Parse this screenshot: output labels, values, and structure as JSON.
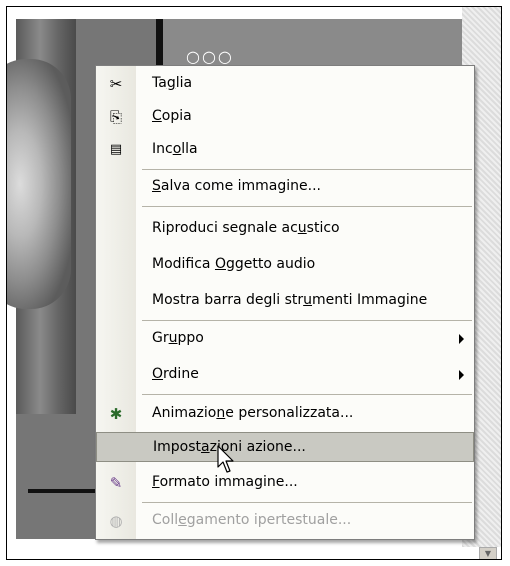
{
  "menu": {
    "items": [
      {
        "label": "Taglia",
        "icon": "scissors-icon",
        "glyph": "✂"
      },
      {
        "label": "Copia",
        "icon": "copy-icon",
        "glyph": "⎘"
      },
      {
        "label": "Incolla",
        "icon": "paste-icon",
        "glyph": "📋"
      },
      {
        "label": "Salva come immagine..."
      },
      {
        "label": "Riproduci segnale acustico"
      },
      {
        "label": "Modifica Oggetto audio"
      },
      {
        "label": "Mostra barra degli strumenti Immagine"
      },
      {
        "label": "Gruppo",
        "submenu": true
      },
      {
        "label": "Ordine",
        "submenu": true
      },
      {
        "label": "Animazione personalizzata...",
        "icon": "animation-icon",
        "glyph": "✱"
      },
      {
        "label": "Impostazioni azione...",
        "state": "hover"
      },
      {
        "label": "Formato immagine...",
        "icon": "format-picture-icon",
        "glyph": "✎"
      },
      {
        "label": "Collegamento ipertestuale...",
        "icon": "hyperlink-icon",
        "glyph": "◍",
        "state": "disabled"
      }
    ]
  },
  "colors": {
    "hover_bg": "#c9c9c2",
    "menu_bg": "#fcfcf9",
    "disabled_text": "#a0a0a0"
  }
}
